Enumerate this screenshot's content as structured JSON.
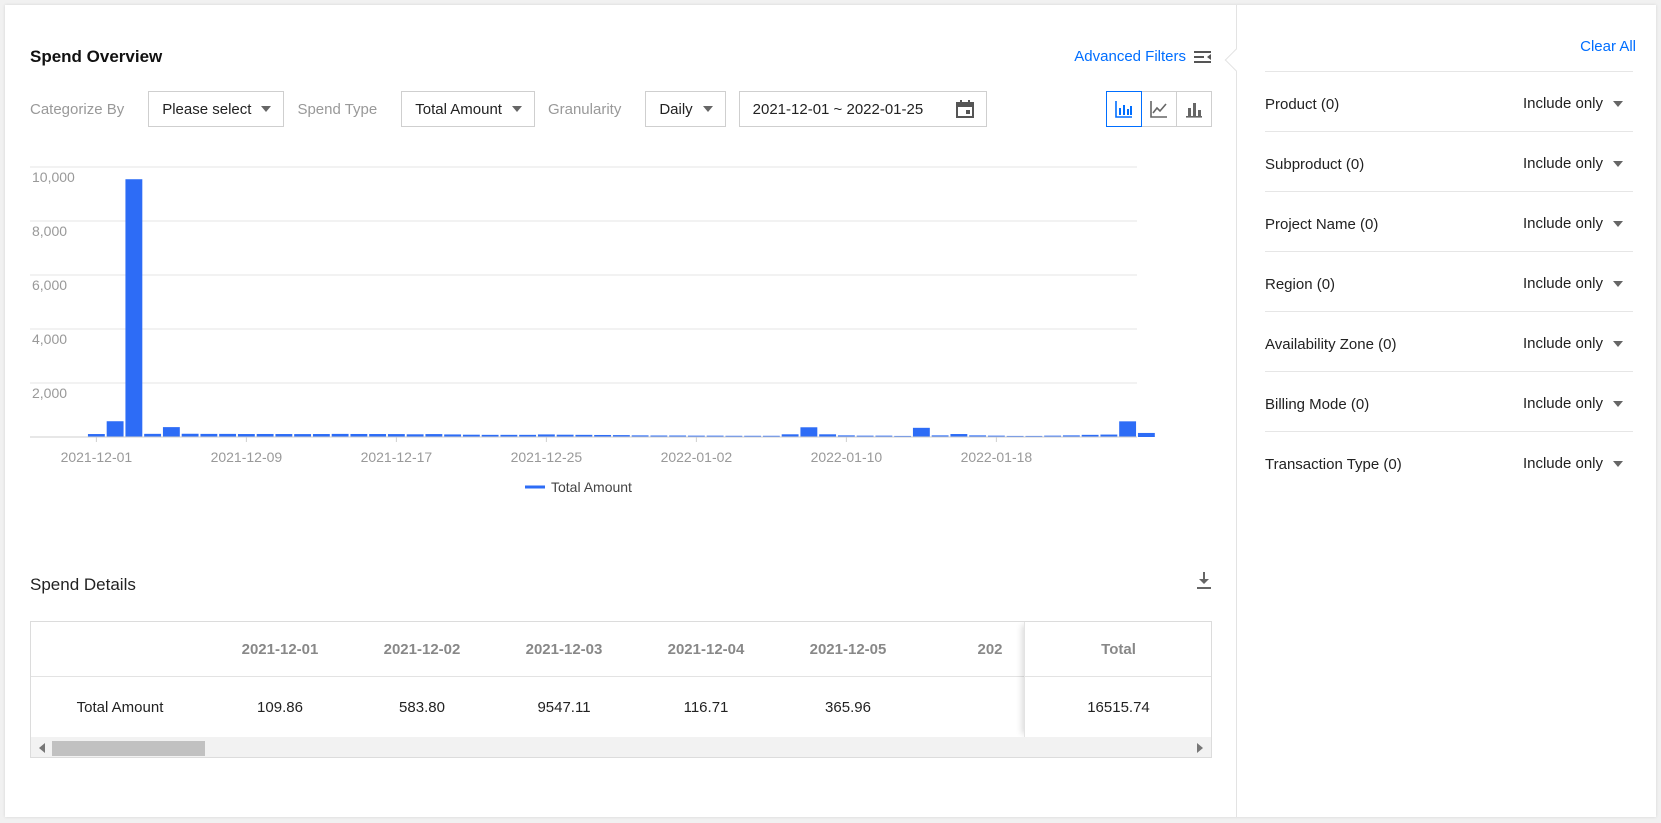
{
  "header": {
    "title": "Spend Overview",
    "advanced_filters": "Advanced Filters"
  },
  "filters": {
    "categorize_by_label": "Categorize By",
    "categorize_by_value": "Please select",
    "spend_type_label": "Spend Type",
    "spend_type_value": "Total Amount",
    "granularity_label": "Granularity",
    "granularity_value": "Daily",
    "date_range": "2021-12-01 ~ 2022-01-25",
    "active_view": "bar"
  },
  "chart_data": {
    "type": "bar",
    "x_start": "2021-12-01",
    "x_end": "2022-01-25",
    "x_ticks": [
      "2021-12-01",
      "2021-12-09",
      "2021-12-17",
      "2021-12-25",
      "2022-01-02",
      "2022-01-10",
      "2022-01-18"
    ],
    "ylim": [
      0,
      10000
    ],
    "y_ticks": [
      2000,
      4000,
      6000,
      8000,
      10000
    ],
    "y_tick_labels": [
      "2,000",
      "4,000",
      "6,000",
      "8,000",
      "10,000"
    ],
    "grid": true,
    "legend": "bottom-center",
    "series": [
      {
        "name": "Total Amount",
        "color": "#2d6cf6",
        "values": [
          109.86,
          583.8,
          9547.11,
          116.71,
          365.96,
          120,
          115,
          115,
          110,
          112,
          110,
          108,
          110,
          115,
          112,
          110,
          108,
          100,
          108,
          95,
          85,
          80,
          80,
          80,
          95,
          85,
          80,
          75,
          70,
          60,
          55,
          55,
          50,
          50,
          45,
          45,
          45,
          100,
          360,
          100,
          60,
          50,
          50,
          40,
          340,
          60,
          110,
          60,
          50,
          40,
          40,
          50,
          60,
          80,
          90,
          580,
          150
        ]
      }
    ]
  },
  "details": {
    "title": "Spend Details",
    "columns": [
      "",
      "2021-12-01",
      "2021-12-02",
      "2021-12-03",
      "2021-12-04",
      "2021-12-05",
      "202"
    ],
    "total_header": "Total",
    "row": {
      "label": "Total Amount",
      "values": [
        "109.86",
        "583.80",
        "9547.11",
        "116.71",
        "365.96"
      ],
      "total": "16515.74"
    }
  },
  "sidebar": {
    "clear_all": "Clear All",
    "filters": [
      {
        "name": "Product  (0)",
        "mode": "Include only"
      },
      {
        "name": "Subproduct  (0)",
        "mode": "Include only"
      },
      {
        "name": "Project Name  (0)",
        "mode": "Include only"
      },
      {
        "name": "Region  (0)",
        "mode": "Include only"
      },
      {
        "name": "Availability Zone  (0)",
        "mode": "Include only"
      },
      {
        "name": "Billing Mode  (0)",
        "mode": "Include only"
      },
      {
        "name": "Transaction Type  (0)",
        "mode": "Include only"
      }
    ]
  },
  "colors": {
    "accent": "#006eff",
    "bar": "#2d6cf6"
  }
}
